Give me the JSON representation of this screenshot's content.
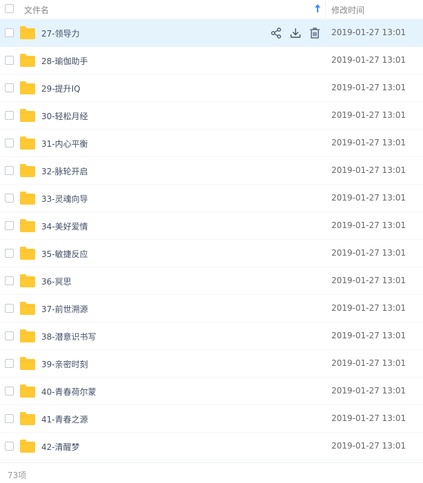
{
  "header": {
    "name_label": "文件名",
    "time_label": "修改时间",
    "sort_icon": "arrow-up-icon"
  },
  "row_actions": [
    {
      "name": "share-icon"
    },
    {
      "name": "download-icon"
    },
    {
      "name": "delete-icon"
    }
  ],
  "files": [
    {
      "name": "27-领导力",
      "modified": "2019-01-27 13:01",
      "hover": true
    },
    {
      "name": "28-瑜伽助手",
      "modified": "2019-01-27 13:01",
      "hover": false
    },
    {
      "name": "29-提升IQ",
      "modified": "2019-01-27 13:01",
      "hover": false
    },
    {
      "name": "30-轻松月经",
      "modified": "2019-01-27 13:01",
      "hover": false
    },
    {
      "name": "31-内心平衡",
      "modified": "2019-01-27 13:01",
      "hover": false
    },
    {
      "name": "32-脉轮开启",
      "modified": "2019-01-27 13:01",
      "hover": false
    },
    {
      "name": "33-灵魂向导",
      "modified": "2019-01-27 13:01",
      "hover": false
    },
    {
      "name": "34-美好爱情",
      "modified": "2019-01-27 13:01",
      "hover": false
    },
    {
      "name": "35-敏捷反应",
      "modified": "2019-01-27 13:01",
      "hover": false
    },
    {
      "name": "36-冥思",
      "modified": "2019-01-27 13:01",
      "hover": false
    },
    {
      "name": "37-前世溯源",
      "modified": "2019-01-27 13:01",
      "hover": false
    },
    {
      "name": "38-潜意识书写",
      "modified": "2019-01-27 13:01",
      "hover": false
    },
    {
      "name": "39-亲密时刻",
      "modified": "2019-01-27 13:01",
      "hover": false
    },
    {
      "name": "40-青春荷尔蒙",
      "modified": "2019-01-27 13:01",
      "hover": false
    },
    {
      "name": "41-青春之源",
      "modified": "2019-01-27 13:01",
      "hover": false
    },
    {
      "name": "42-清醒梦",
      "modified": "2019-01-27 13:01",
      "hover": false
    }
  ],
  "footer": {
    "count_label": "73项"
  },
  "colors": {
    "folder": "#ffc933",
    "hover_row": "#e5f3fd",
    "sort_arrow": "#3b8cff",
    "action_icon": "#424e67"
  }
}
